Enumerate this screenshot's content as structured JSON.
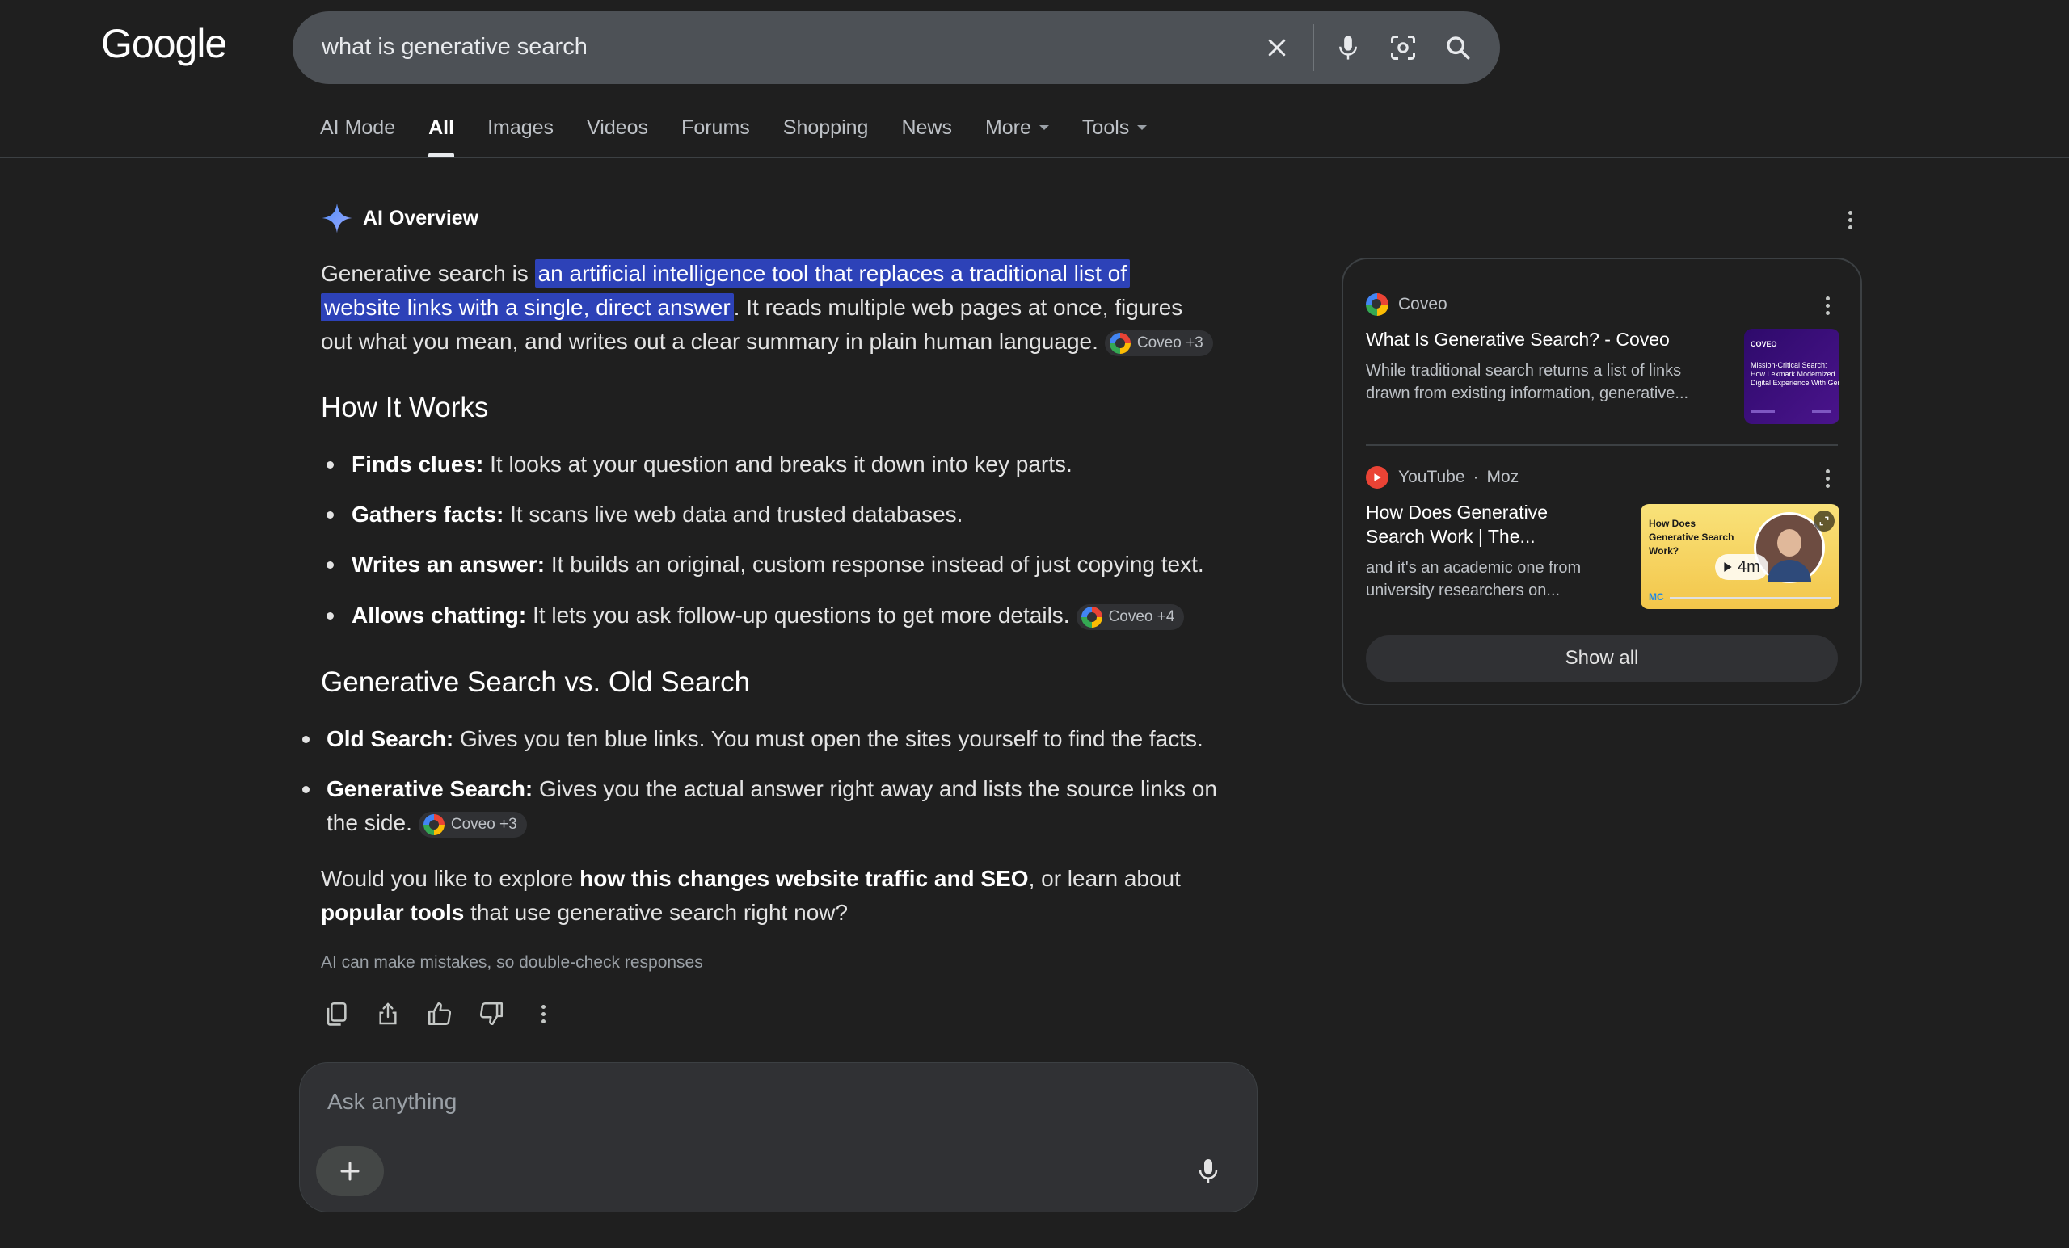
{
  "header": {
    "logo_text": "Google",
    "search_query": "what is generative search"
  },
  "tabs": [
    {
      "label": "AI Mode",
      "active": false
    },
    {
      "label": "All",
      "active": true
    },
    {
      "label": "Images",
      "active": false
    },
    {
      "label": "Videos",
      "active": false
    },
    {
      "label": "Forums",
      "active": false
    },
    {
      "label": "Shopping",
      "active": false
    },
    {
      "label": "News",
      "active": false
    },
    {
      "label": "More",
      "active": false,
      "dropdown": true
    },
    {
      "label": "Tools",
      "active": false,
      "dropdown": true
    }
  ],
  "ai_overview": {
    "title": "AI Overview",
    "intro": {
      "before": "Generative search is ",
      "highlight_line1": "an artificial intelligence tool that replaces a traditional list of",
      "highlight_line2": "website links with a single, direct answer",
      "after_line2": ". It reads multiple web pages at once, figures",
      "line3": "out what you mean, and writes out a clear summary in plain human language.",
      "chip": "Coveo +3"
    },
    "section1": {
      "heading": "How It Works",
      "items": [
        {
          "bold": "Finds clues:",
          "text": " It looks at your question and breaks it down into key parts."
        },
        {
          "bold": "Gathers facts:",
          "text": " It scans live web data and trusted databases."
        },
        {
          "bold": "Writes an answer:",
          "text": " It builds an original, custom response instead of just copying text."
        },
        {
          "bold": "Allows chatting:",
          "text": " It lets you ask follow-up questions to get more details.",
          "chip": "Coveo +4"
        }
      ]
    },
    "section2": {
      "heading": "Generative Search vs. Old Search",
      "items": [
        {
          "bold": "Old Search:",
          "text": " Gives you ten blue links. You must open the sites yourself to find the facts."
        },
        {
          "bold": "Generative Search:",
          "text": " Gives you the actual answer right away and lists the source links on",
          "text2": "the side.",
          "chip": "Coveo +3"
        }
      ]
    },
    "closing": {
      "p1": "Would you like to explore ",
      "b1": "how this changes website traffic and SEO",
      "p2": ", or learn about",
      "b2": "popular tools",
      "p3": " that use generative search right now?"
    },
    "disclaimer": "AI can make mistakes, so double-check responses"
  },
  "ask": {
    "placeholder": "Ask anything"
  },
  "sources": {
    "items": [
      {
        "site": "Coveo",
        "title": "What Is Generative Search? - Coveo",
        "desc1": "While traditional search returns a list of links",
        "desc2": "drawn from existing information, generative...",
        "thumb": {
          "brand": "COVEO",
          "line1": "Mission-Critical Search:",
          "line2": "How Lexmark Modernized",
          "line3": "Digital Experience With Gene"
        }
      },
      {
        "site": "YouTube",
        "site2": "Moz",
        "title1": "How Does Generative",
        "title2": "Search Work | The...",
        "desc1": "and it's an academic one from",
        "desc2": "university researchers on...",
        "thumb": {
          "line1": "How Does",
          "line2": "Generative Search",
          "line3": "Work?",
          "duration": "4m",
          "logo": "MC"
        }
      }
    ],
    "show_all": "Show all"
  },
  "colors": {
    "background": "#1f1f1f",
    "highlight": "#2d42b8",
    "search_bar": "#4d5156",
    "panel_border": "#3c4043"
  }
}
